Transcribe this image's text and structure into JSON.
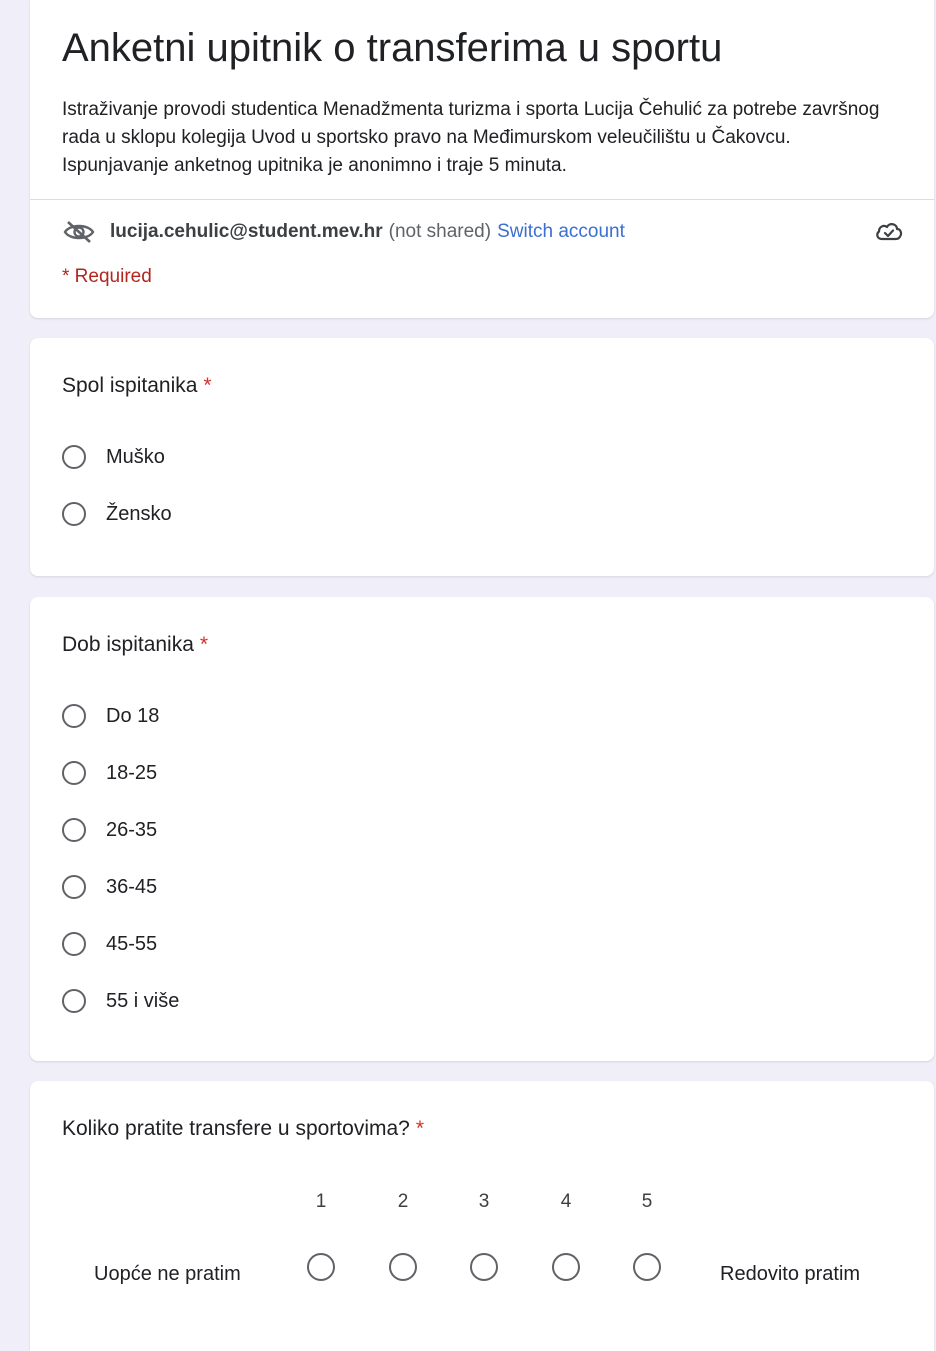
{
  "form": {
    "title": "Anketni upitnik o transferima u sportu",
    "description": "Istraživanje provodi studentica Menadžmenta turizma i sporta Lucija Čehulić za potrebe završnog rada u sklopu kolegija Uvod u sportsko pravo na Međimurskom veleučilištu u Čakovcu. Ispunjavanje anketnog upitnika je anonimno i traje 5 minuta."
  },
  "account": {
    "email": "lucija.cehulic@student.mev.hr",
    "shared_status": "(not shared)",
    "switch_label": "Switch account",
    "privacy_icon": "eye-off-icon",
    "save_icon": "cloud-check-icon"
  },
  "required_note": "* Required",
  "questions": [
    {
      "title": "Spol ispitanika",
      "required_mark": "*",
      "options": [
        "Muško",
        "Žensko"
      ]
    },
    {
      "title": "Dob ispitanika",
      "required_mark": "*",
      "options": [
        "Do 18",
        "18-25",
        "26-35",
        "36-45",
        "45-55",
        "55 i više"
      ]
    },
    {
      "title": "Koliko pratite transfere u sportovima?",
      "required_mark": "*",
      "scale": {
        "numbers": [
          "1",
          "2",
          "3",
          "4",
          "5"
        ],
        "low_label": "Uopće ne pratim",
        "high_label": "Redovito pratim"
      }
    }
  ],
  "colors": {
    "background": "#f0eef8",
    "link": "#3b6fd0",
    "required": "#d93025"
  }
}
